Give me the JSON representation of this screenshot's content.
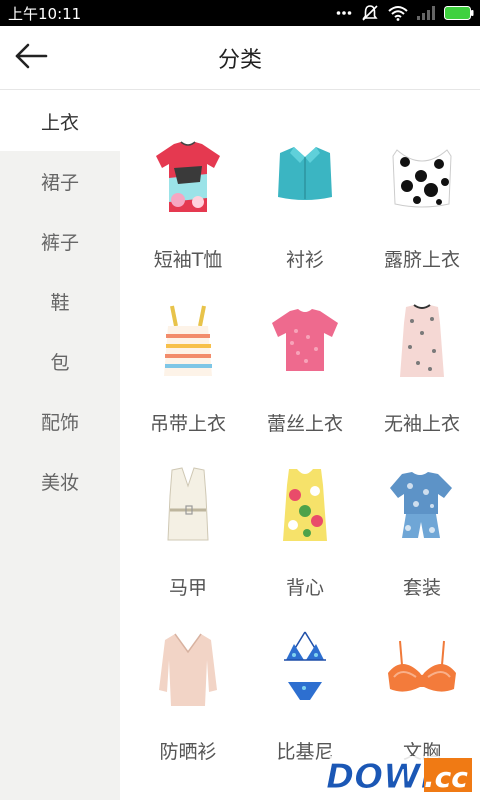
{
  "status_bar": {
    "time": "上午10:11",
    "icons": [
      "more-dots-icon",
      "notification-muted-icon",
      "wifi-icon",
      "signal-icon",
      "battery-icon"
    ]
  },
  "header": {
    "back_icon": "back-arrow-icon",
    "title": "分类"
  },
  "sidebar": {
    "items": [
      {
        "label": "上衣",
        "active": true
      },
      {
        "label": "裙子",
        "active": false
      },
      {
        "label": "裤子",
        "active": false
      },
      {
        "label": "鞋",
        "active": false
      },
      {
        "label": "包",
        "active": false
      },
      {
        "label": "配饰",
        "active": false
      },
      {
        "label": "美妆",
        "active": false
      }
    ]
  },
  "categories": [
    {
      "label": "短袖T恤",
      "icon": "short-sleeve-tshirt-icon"
    },
    {
      "label": "衬衫",
      "icon": "shirt-icon"
    },
    {
      "label": "露脐上衣",
      "icon": "crop-top-icon"
    },
    {
      "label": "吊带上衣",
      "icon": "camisole-icon"
    },
    {
      "label": "蕾丝上衣",
      "icon": "lace-top-icon"
    },
    {
      "label": "无袖上衣",
      "icon": "sleeveless-top-icon"
    },
    {
      "label": "马甲",
      "icon": "vest-icon"
    },
    {
      "label": "背心",
      "icon": "tank-top-icon"
    },
    {
      "label": "套装",
      "icon": "outfit-set-icon"
    },
    {
      "label": "防晒衫",
      "icon": "sun-protection-cardigan-icon"
    },
    {
      "label": "比基尼",
      "icon": "bikini-icon"
    },
    {
      "label": "文胸",
      "icon": "bra-icon"
    }
  ],
  "watermark": {
    "text_left": "DOWN",
    "text_right": ".cc"
  },
  "colors": {
    "status_bar_bg": "#000000",
    "sidebar_bg": "#f2f2f0",
    "active_item_bg": "#ffffff",
    "battery": "#3fd13f",
    "watermark_blue": "#1b57b5",
    "watermark_orange": "#f07a14"
  }
}
